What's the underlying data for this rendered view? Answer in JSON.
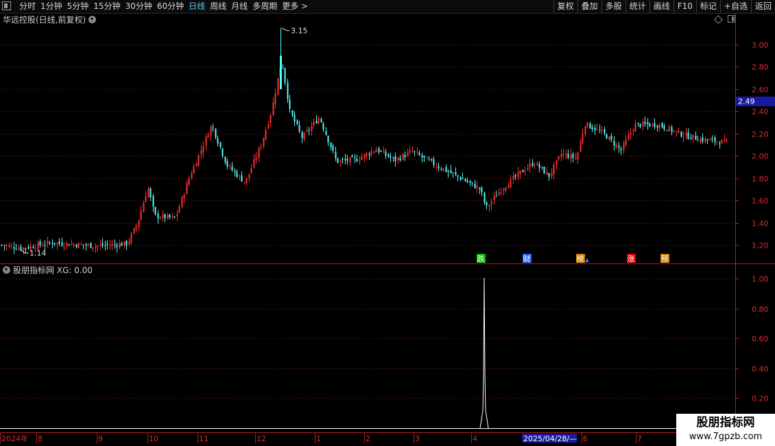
{
  "toolbar": {
    "tabs": [
      {
        "label": "分时",
        "active": false
      },
      {
        "label": "1分钟",
        "active": false
      },
      {
        "label": "5分钟",
        "active": false
      },
      {
        "label": "15分钟",
        "active": false
      },
      {
        "label": "30分钟",
        "active": false
      },
      {
        "label": "60分钟",
        "active": false
      },
      {
        "label": "日线",
        "active": true
      },
      {
        "label": "周线",
        "active": false
      },
      {
        "label": "月线",
        "active": false
      },
      {
        "label": "多周期",
        "active": false
      },
      {
        "label": "更多 >",
        "active": false
      }
    ],
    "right_buttons": [
      "复权",
      "叠加",
      "多股",
      "统计",
      "画线",
      "F10",
      "标记",
      "+自选",
      "返回"
    ]
  },
  "main_chart": {
    "title": "华远控股(日线,前复权)",
    "high_label": "3.15",
    "low_label": "1.14",
    "current_price": "2.49",
    "y_ticks": [
      "3.00",
      "2.80",
      "2.60",
      "2.40",
      "2.20",
      "2.00",
      "1.80",
      "1.60",
      "1.40",
      "1.20"
    ],
    "event_badges": [
      {
        "text": "跌",
        "color": "#00c000"
      },
      {
        "text": "财",
        "color": "#3060ff"
      },
      {
        "text": "榜",
        "color": "#d08000"
      },
      {
        "text": "涨",
        "color": "#e00000"
      },
      {
        "text": "预",
        "color": "#d08000"
      }
    ]
  },
  "indicator": {
    "title": "股朋指标网",
    "value_text": "XG: 0.00",
    "y_ticks": [
      "1.00",
      "0.80",
      "0.60",
      "0.40",
      "0.20"
    ]
  },
  "x_axis": {
    "labels": [
      "2024年",
      "8",
      "9",
      "10",
      "11",
      "12",
      "1",
      "2",
      "3",
      "4",
      "6",
      "7"
    ],
    "highlight_date": "2025/04/28/—"
  },
  "watermark": {
    "line1": "股朋指标网",
    "line2": "www.7gpzb.com"
  },
  "colors": {
    "up": "#ff3232",
    "down": "#54fcfc",
    "grid": "#8b1a1a",
    "axis": "#b02020",
    "active_tab": "#5bc8ff",
    "price_tag_bg": "#1a1aa0"
  }
}
